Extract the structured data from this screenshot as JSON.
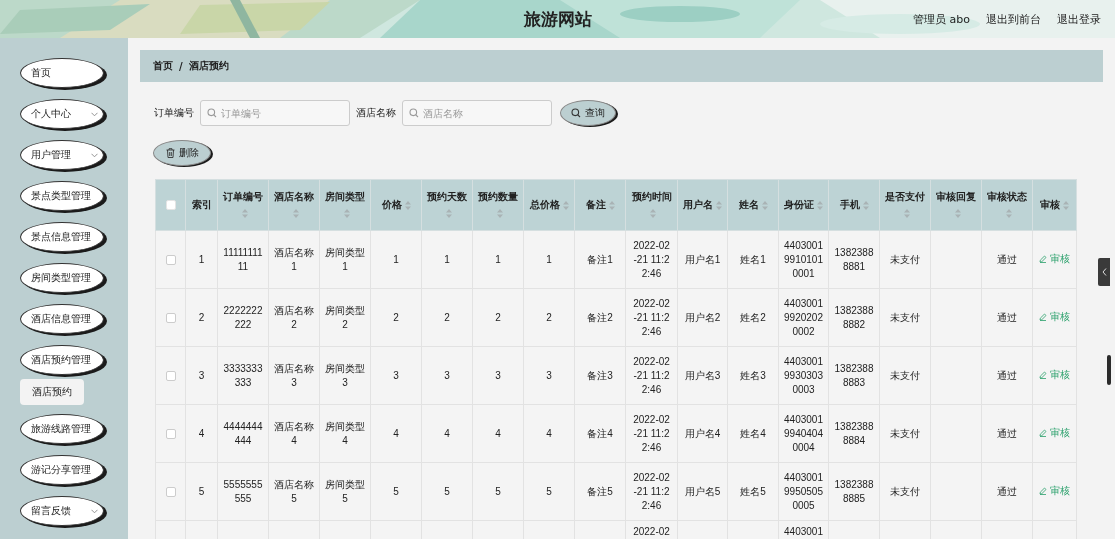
{
  "header": {
    "title": "旅游网站",
    "user": "管理员 abo",
    "links": [
      "退出到前台",
      "退出登录"
    ]
  },
  "sidebar": {
    "items": [
      {
        "label": "首页",
        "has_submenu": false
      },
      {
        "label": "个人中心",
        "has_submenu": true
      },
      {
        "label": "用户管理",
        "has_submenu": true
      },
      {
        "label": "景点类型管理",
        "has_submenu": false
      },
      {
        "label": "景点信息管理",
        "has_submenu": false
      },
      {
        "label": "房间类型管理",
        "has_submenu": false
      },
      {
        "label": "酒店信息管理",
        "has_submenu": false
      },
      {
        "label": "酒店预约管理",
        "has_submenu": false,
        "children": [
          {
            "label": "酒店预约"
          }
        ]
      },
      {
        "label": "旅游线路管理",
        "has_submenu": false
      },
      {
        "label": "游记分享管理",
        "has_submenu": false
      },
      {
        "label": "留言反馈",
        "has_submenu": true
      }
    ]
  },
  "breadcrumb": {
    "items": [
      "首页",
      "酒店预约"
    ],
    "separator": "/"
  },
  "search": {
    "fields": [
      {
        "label": "订单编号",
        "placeholder": "订单编号"
      },
      {
        "label": "酒店名称",
        "placeholder": "酒店名称"
      }
    ],
    "button": "查询"
  },
  "toolbar": {
    "delete_button": "删除"
  },
  "table": {
    "select_all": {
      "checked": false
    },
    "columns": [
      {
        "kind": "text",
        "label": "索引",
        "sortable": false
      },
      {
        "kind": "text",
        "label": "订单编号",
        "sortable": true
      },
      {
        "kind": "text",
        "label": "酒店名称",
        "sortable": true
      },
      {
        "kind": "text",
        "label": "房间类型",
        "sortable": true
      },
      {
        "kind": "text",
        "label": "价格",
        "sortable": true
      },
      {
        "kind": "text",
        "label": "预约天数",
        "sortable": true
      },
      {
        "kind": "text",
        "label": "预约数量",
        "sortable": true
      },
      {
        "kind": "text",
        "label": "总价格",
        "sortable": true
      },
      {
        "kind": "text",
        "label": "备注",
        "sortable": true
      },
      {
        "kind": "text",
        "label": "预约时间",
        "sortable": true
      },
      {
        "kind": "text",
        "label": "用户名",
        "sortable": true
      },
      {
        "kind": "text",
        "label": "姓名",
        "sortable": true
      },
      {
        "kind": "text",
        "label": "身份证",
        "sortable": true
      },
      {
        "kind": "text",
        "label": "手机",
        "sortable": true
      },
      {
        "kind": "text",
        "label": "是否支付",
        "sortable": true
      },
      {
        "kind": "text",
        "label": "审核回复",
        "sortable": true
      },
      {
        "kind": "text",
        "label": "审核状态",
        "sortable": true
      },
      {
        "kind": "action",
        "label": "审核",
        "sortable": true
      }
    ],
    "rows": [
      {
        "checked": false,
        "cells": [
          "1",
          "1111111111",
          "酒店名称1",
          "房间类型1",
          "1",
          "1",
          "1",
          "1",
          "备注1",
          "2022-02-21 11:22:46",
          "用户名1",
          "姓名1",
          "440300199101010001",
          "13823888881",
          "未支付",
          null,
          "通过",
          "审核"
        ]
      },
      {
        "checked": false,
        "cells": [
          "2",
          "2222222222",
          "酒店名称2",
          "房间类型2",
          "2",
          "2",
          "2",
          "2",
          "备注2",
          "2022-02-21 11:22:46",
          "用户名2",
          "姓名2",
          "440300199202020002",
          "13823888882",
          "未支付",
          null,
          "通过",
          "审核"
        ]
      },
      {
        "checked": false,
        "cells": [
          "3",
          "3333333333",
          "酒店名称3",
          "房间类型3",
          "3",
          "3",
          "3",
          "3",
          "备注3",
          "2022-02-21 11:22:46",
          "用户名3",
          "姓名3",
          "440300199303030003",
          "13823888883",
          "未支付",
          null,
          "通过",
          "审核"
        ]
      },
      {
        "checked": false,
        "cells": [
          "4",
          "4444444444",
          "酒店名称4",
          "房间类型4",
          "4",
          "4",
          "4",
          "4",
          "备注4",
          "2022-02-21 11:22:46",
          "用户名4",
          "姓名4",
          "440300199404040004",
          "13823888884",
          "未支付",
          null,
          "通过",
          "审核"
        ]
      },
      {
        "checked": false,
        "cells": [
          "5",
          "5555555555",
          "酒店名称5",
          "房间类型5",
          "5",
          "5",
          "5",
          "5",
          "备注5",
          "2022-02-21 11:22:46",
          "用户名5",
          "姓名5",
          "440300199505050005",
          "13823888885",
          "未支付",
          null,
          "通过",
          "审核"
        ]
      },
      {
        "cells": [
          null,
          null,
          null,
          null,
          null,
          null,
          null,
          null,
          null,
          "2022-02",
          null,
          null,
          "4403001",
          null,
          null,
          null,
          null,
          null
        ]
      }
    ]
  }
}
